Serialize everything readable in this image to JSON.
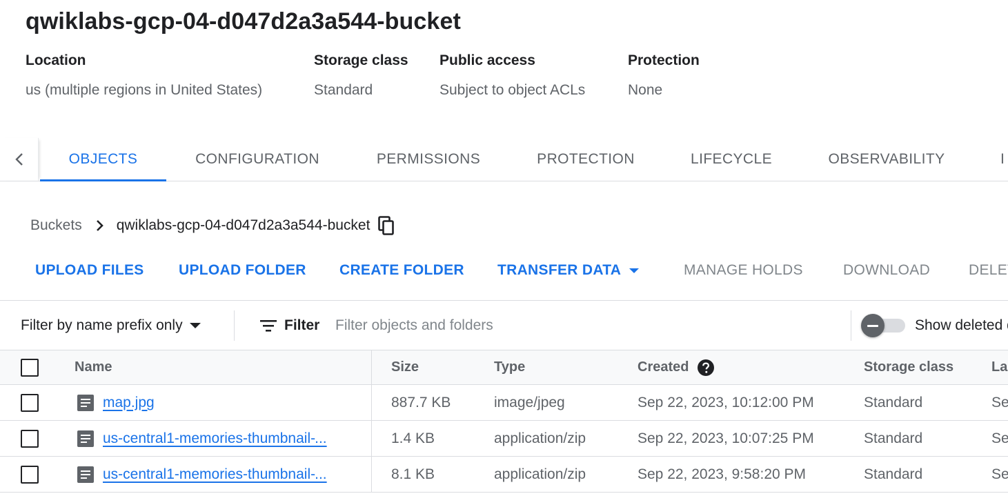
{
  "bucket": {
    "title": "qwiklabs-gcp-04-d047d2a3a544-bucket"
  },
  "meta": {
    "location": {
      "label": "Location",
      "value": "us (multiple regions in United States)"
    },
    "storage_class": {
      "label": "Storage class",
      "value": "Standard"
    },
    "public_access": {
      "label": "Public access",
      "value": "Subject to object ACLs"
    },
    "protection": {
      "label": "Protection",
      "value": "None"
    }
  },
  "tabs": [
    {
      "label": "OBJECTS",
      "active": true
    },
    {
      "label": "CONFIGURATION",
      "active": false
    },
    {
      "label": "PERMISSIONS",
      "active": false
    },
    {
      "label": "PROTECTION",
      "active": false
    },
    {
      "label": "LIFECYCLE",
      "active": false
    },
    {
      "label": "OBSERVABILITY",
      "active": false
    },
    {
      "label": "I",
      "active": false
    }
  ],
  "breadcrumb": {
    "root": "Buckets",
    "current": "qwiklabs-gcp-04-d047d2a3a544-bucket"
  },
  "actions": {
    "upload_files": "UPLOAD FILES",
    "upload_folder": "UPLOAD FOLDER",
    "create_folder": "CREATE FOLDER",
    "transfer_data": "TRANSFER DATA",
    "manage_holds": "MANAGE HOLDS",
    "download": "DOWNLOAD",
    "delete": "DELETE"
  },
  "filter_bar": {
    "prefix_select": "Filter by name prefix only",
    "filter_label": "Filter",
    "filter_placeholder": "Filter objects and folders",
    "show_deleted_label": "Show deleted data",
    "show_deleted_on": false
  },
  "table": {
    "headers": {
      "name": "Name",
      "size": "Size",
      "type": "Type",
      "created": "Created",
      "storage_class": "Storage class",
      "last_modified": "Last modified"
    },
    "rows": [
      {
        "name": "map.jpg",
        "size": "887.7 KB",
        "type": "image/jpeg",
        "created": "Sep 22, 2023, 10:12:00 PM",
        "storage_class": "Standard",
        "last_modified": "Sep"
      },
      {
        "name": "us-central1-memories-thumbnail-",
        "size": "1.4 KB",
        "type": "application/zip",
        "created": "Sep 22, 2023, 10:07:25 PM",
        "storage_class": "Standard",
        "last_modified": "Sep"
      },
      {
        "name": "us-central1-memories-thumbnail-",
        "size": "8.1 KB",
        "type": "application/zip",
        "created": "Sep 22, 2023, 9:58:20 PM",
        "storage_class": "Standard",
        "last_modified": "Sep"
      }
    ]
  },
  "colors": {
    "accent": "#1a73e8",
    "text_primary": "#202124",
    "text_secondary": "#5f6368",
    "divider": "#dadce0"
  }
}
